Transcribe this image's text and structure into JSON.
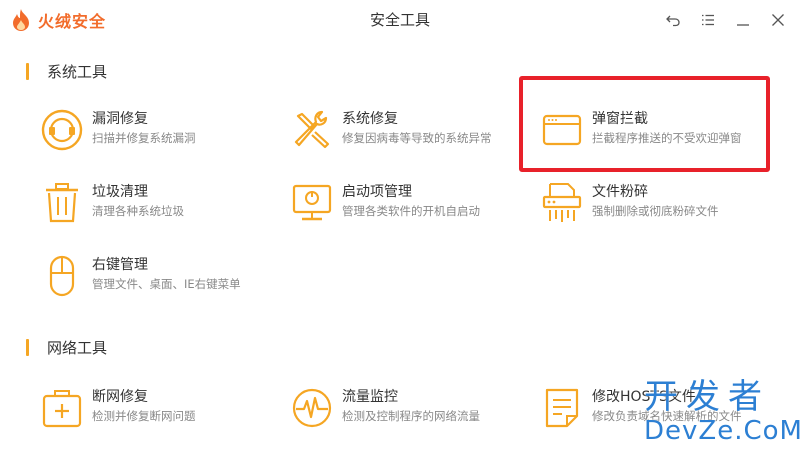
{
  "app": {
    "logo_text": "火绒安全",
    "window_title": "安全工具",
    "brand_color": "#f26c2b",
    "accent_color": "#f5a623",
    "controls": [
      "back-icon",
      "menu-icon",
      "minimize-icon",
      "close-icon"
    ]
  },
  "sections": [
    {
      "title": "系统工具",
      "tools": [
        {
          "name": "漏洞修复",
          "desc": "扫描并修复系统漏洞",
          "icon": "vulnerability-repair-icon"
        },
        {
          "name": "系统修复",
          "desc": "修复因病毒等导致的系统异常",
          "icon": "system-repair-icon"
        },
        {
          "name": "弹窗拦截",
          "desc": "拦截程序推送的不受欢迎弹窗",
          "icon": "popup-block-icon"
        },
        {
          "name": "垃圾清理",
          "desc": "清理各种系统垃圾",
          "icon": "trash-icon"
        },
        {
          "name": "启动项管理",
          "desc": "管理各类软件的开机自启动",
          "icon": "startup-icon"
        },
        {
          "name": "文件粉碎",
          "desc": "强制删除或彻底粉碎文件",
          "icon": "shredder-icon"
        },
        {
          "name": "右键管理",
          "desc": "管理文件、桌面、IE右键菜单",
          "icon": "mouse-icon"
        }
      ]
    },
    {
      "title": "网络工具",
      "tools": [
        {
          "name": "断网修复",
          "desc": "检测并修复断网问题",
          "icon": "network-repair-icon"
        },
        {
          "name": "流量监控",
          "desc": "检测及控制程序的网络流量",
          "icon": "traffic-monitor-icon"
        },
        {
          "name": "修改HOSTS文件",
          "desc": "修改负责域名快速解析的文件",
          "icon": "hosts-file-icon"
        }
      ]
    }
  ],
  "watermark": {
    "line1": "开发者",
    "line2": "DevZe.CoM"
  }
}
